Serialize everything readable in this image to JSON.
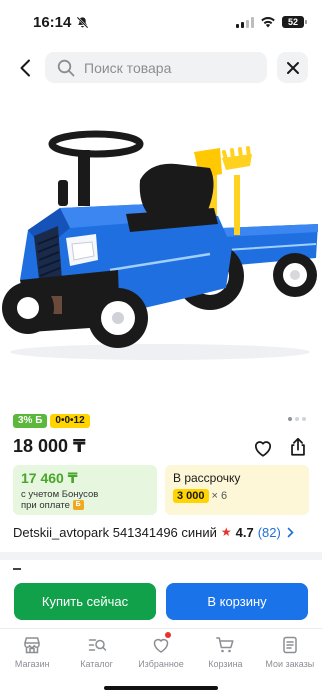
{
  "status_bar": {
    "time": "16:14",
    "battery": "52"
  },
  "search": {
    "placeholder": "Поиск товара"
  },
  "product": {
    "badge_bonus": "3% Б",
    "badge_installment": "0•0•12",
    "price": "18 000 ₸",
    "seller_line": "Detskii_avtopark 541341496 синий",
    "rating": "4.7",
    "reviews": "(82)"
  },
  "bonus_card": {
    "price": "17 460 ₸",
    "line1": "с учетом Бонусов",
    "line2": "при оплате",
    "chip": "Б"
  },
  "installment_card": {
    "title": "В рассрочку",
    "amount": "3 000",
    "multiplier": "× 6"
  },
  "actions": {
    "buy_now": "Купить сейчас",
    "add_to_cart": "В корзину"
  },
  "nav": [
    {
      "label": "Магазин",
      "icon": "store-icon"
    },
    {
      "label": "Каталог",
      "icon": "catalog-search-icon"
    },
    {
      "label": "Избранное",
      "icon": "heart-icon"
    },
    {
      "label": "Корзина",
      "icon": "cart-icon"
    },
    {
      "label": "Мои заказы",
      "icon": "orders-icon"
    }
  ],
  "colors": {
    "green": "#12a14b",
    "blue": "#1a73e8",
    "bonus_green": "#5bb83a",
    "yellow": "#ffd400",
    "star_red": "#e8322c"
  },
  "gallery": {
    "total_images": 3,
    "current_image": 1
  }
}
